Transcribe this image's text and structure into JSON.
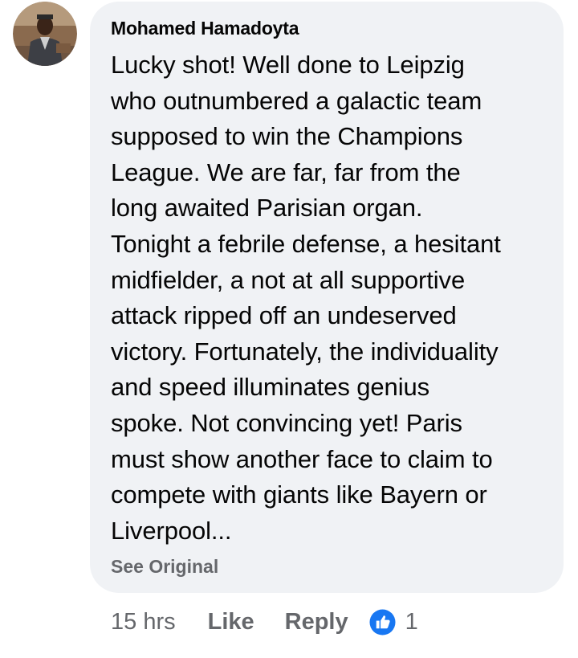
{
  "comment": {
    "author": "Mohamed Hamadoyta",
    "text_lines": [
      "Lucky shot! Well done to Leipzig",
      "who outnumbered a galactic team",
      "supposed to win the Champions",
      "League. We are far, far from the",
      "long awaited Parisian organ.",
      "Tonight a febrile defense, a hesitant",
      "midfielder, a not at all supportive",
      "attack ripped off an undeserved",
      "victory. Fortunately, the individuality",
      "and speed illuminates genius",
      "spoke. Not convincing yet! Paris",
      "must show another face to claim to",
      "compete with giants like Bayern or",
      "Liverpool..."
    ],
    "see_original_label": "See Original"
  },
  "actions": {
    "timestamp": "15 hrs",
    "like_label": "Like",
    "reply_label": "Reply",
    "reaction_count": "1",
    "reaction_icon": "like-thumb-icon"
  },
  "colors": {
    "bubble_bg": "#f0f2f5",
    "text": "#050505",
    "secondary_text": "#65676b",
    "like_blue": "#1877f2"
  }
}
